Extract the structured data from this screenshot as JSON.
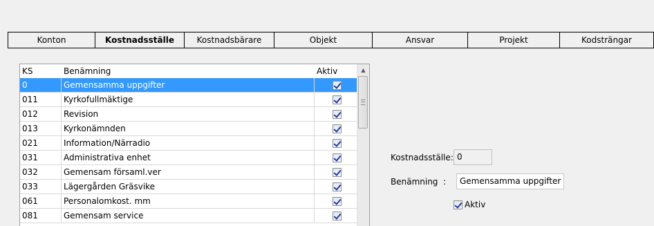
{
  "tabs": [
    {
      "label": "Konton",
      "active": false
    },
    {
      "label": "Kostnadsställe",
      "active": true
    },
    {
      "label": "Kostnadsbärare",
      "active": false
    },
    {
      "label": "Objekt",
      "active": false
    },
    {
      "label": "Ansvar",
      "active": false
    },
    {
      "label": "Projekt",
      "active": false
    },
    {
      "label": "Kodsträngar",
      "active": false
    }
  ],
  "grid": {
    "headers": {
      "ks": "KS",
      "name": "Benämning",
      "active": "Aktiv"
    },
    "rows": [
      {
        "ks": "0",
        "name": "Gemensamma uppgifter",
        "active": true,
        "selected": true
      },
      {
        "ks": "011",
        "name": "Kyrkofullmäktige",
        "active": true
      },
      {
        "ks": "012",
        "name": "Revision",
        "active": true
      },
      {
        "ks": "013",
        "name": "Kyrkonämnden",
        "active": true
      },
      {
        "ks": "021",
        "name": "Information/Närradio",
        "active": true
      },
      {
        "ks": "031",
        "name": "Administrativa enhet",
        "active": true
      },
      {
        "ks": "032",
        "name": "Gemensam församl.ver",
        "active": true
      },
      {
        "ks": "033",
        "name": "Lägergården Gräsvike",
        "active": true
      },
      {
        "ks": "061",
        "name": "Personalomkost. mm",
        "active": true
      },
      {
        "ks": "081",
        "name": "Gemensam service",
        "active": true
      }
    ]
  },
  "detail": {
    "ks_label": "Kostnadsställe:",
    "ks_value": "0",
    "name_label": "Benämning  :",
    "name_value": "Gemensamma uppgifter",
    "aktiv_label": "Aktiv",
    "aktiv_checked": true
  }
}
